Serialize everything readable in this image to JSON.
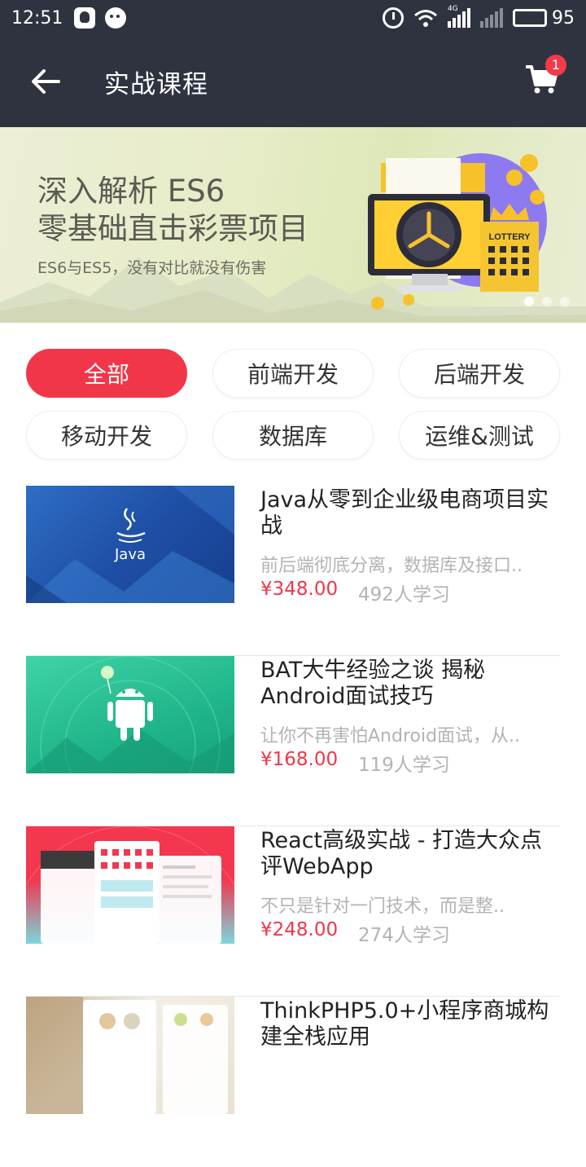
{
  "status_bar": {
    "time": "12:51",
    "battery_percent": "95",
    "network_label": "4G",
    "battery_level": 0.95
  },
  "app_bar": {
    "title": "实战课程",
    "cart_count": "1"
  },
  "banner": {
    "line1": "深入解析 ES6",
    "line2": "零基础直击彩票项目",
    "subtitle": "ES6与ES5，没有对比就没有伤害",
    "art_label": "LOTTERY"
  },
  "categories": [
    {
      "label": "全部",
      "active": true
    },
    {
      "label": "前端开发",
      "active": false
    },
    {
      "label": "后端开发",
      "active": false
    },
    {
      "label": "移动开发",
      "active": false
    },
    {
      "label": "数据库",
      "active": false
    },
    {
      "label": "运维&测试",
      "active": false
    }
  ],
  "courses": [
    {
      "title": "Java从零到企业级电商项目实战",
      "description": "前后端彻底分离，数据库及接口..",
      "price": "¥348.00",
      "learners": "492人学习",
      "thumb_text": "Java"
    },
    {
      "title": "BAT大牛经验之谈 揭秘Android面试技巧",
      "description": "让你不再害怕Android面试，从..",
      "price": "¥168.00",
      "learners": "119人学习"
    },
    {
      "title": "React高级实战 - 打造大众点评WebApp",
      "description": "不只是针对一门技术，而是整..",
      "price": "¥248.00",
      "learners": "274人学习"
    },
    {
      "title": "ThinkPHP5.0+小程序商城构建全栈应用",
      "description": "",
      "price": "",
      "learners": ""
    }
  ],
  "colors": {
    "header_bg": "#2f3340",
    "accent": "#f2364a"
  }
}
